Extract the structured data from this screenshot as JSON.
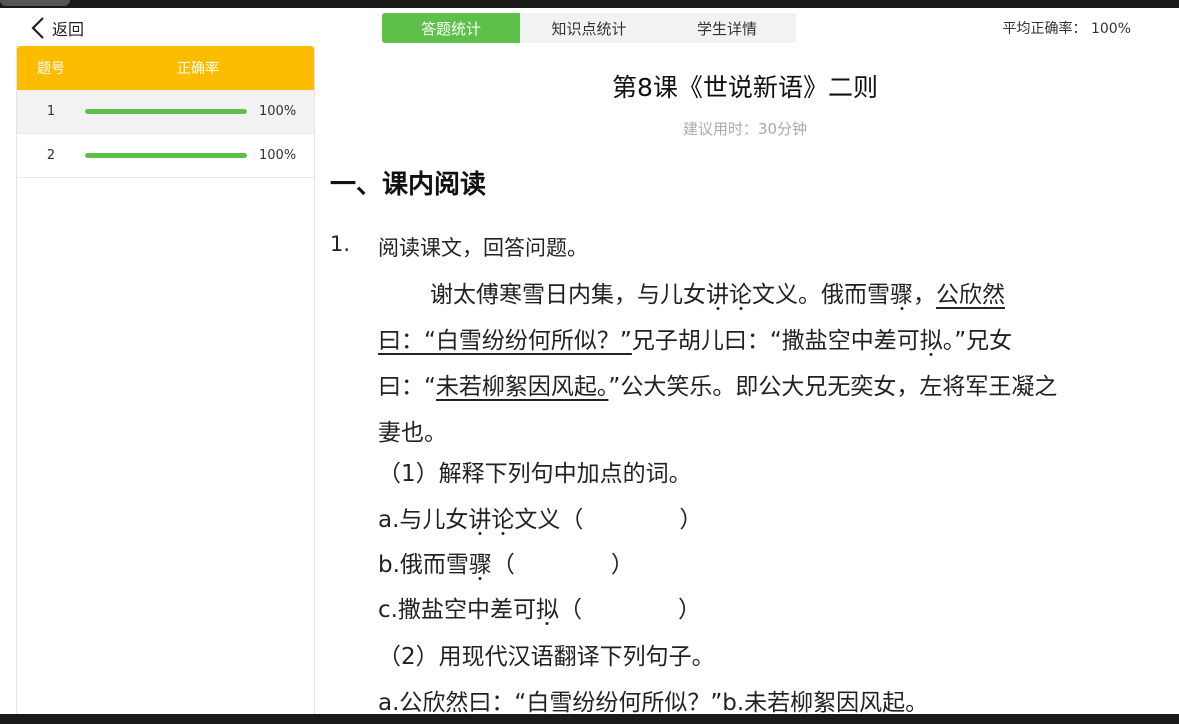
{
  "header": {
    "back_label": "返回",
    "tabs": [
      "答题统计",
      "知识点统计",
      "学生详情"
    ],
    "active_tab": 0,
    "avg_label": "平均正确率：",
    "avg_value": "100%"
  },
  "sidebar": {
    "col_number": "题号",
    "col_accuracy": "正确率",
    "rows": [
      {
        "number": "1",
        "accuracy": "100%",
        "progress": 1.0
      },
      {
        "number": "2",
        "accuracy": "100%",
        "progress": 1.0
      }
    ]
  },
  "lesson": {
    "title": "第8课《世说新语》二则",
    "suggested_time": "建议用时：30分钟",
    "section": "一、课内阅读"
  },
  "question": {
    "number": "1.",
    "prompt": "阅读课文，回答问题。",
    "passage": {
      "p1": "谢太傅寒雪日内集，与儿女",
      "p2": "讲",
      "p3": "论",
      "p4": "文义。俄而雪",
      "p5": "骤",
      "p6": "，",
      "p7": "公欣然",
      "p8": "曰：“白雪纷纷何所似？”",
      "p9": "兄子胡儿曰：“撒盐空中差可",
      "p10": "拟",
      "p11": "。”兄女",
      "p12": "曰：“",
      "p13": "未若柳絮因风起。",
      "p14": "”公大笑乐。即公大兄无奕女，左将军王凝之",
      "p15": "妻也。"
    },
    "sub1": "（1）解释下列句中加点的词。",
    "a_pre": "a.与儿女",
    "a_d1": "讲",
    "a_d2": "论",
    "a_post": "文义（",
    "b_pre": "b.俄而雪",
    "b_d1": "骤",
    "b_post": "（",
    "c_pre": "c.撒盐空中差可",
    "c_d1": "拟",
    "c_post": "（",
    "close": "）",
    "sub2": "（2）用现代汉语翻译下列句子。",
    "translate": "a.公欣然曰：“白雪纷纷何所似？”b.未若柳絮因风起。"
  },
  "colors": {
    "accent_green": "#5cc049",
    "header_yellow": "#fcbc00"
  }
}
